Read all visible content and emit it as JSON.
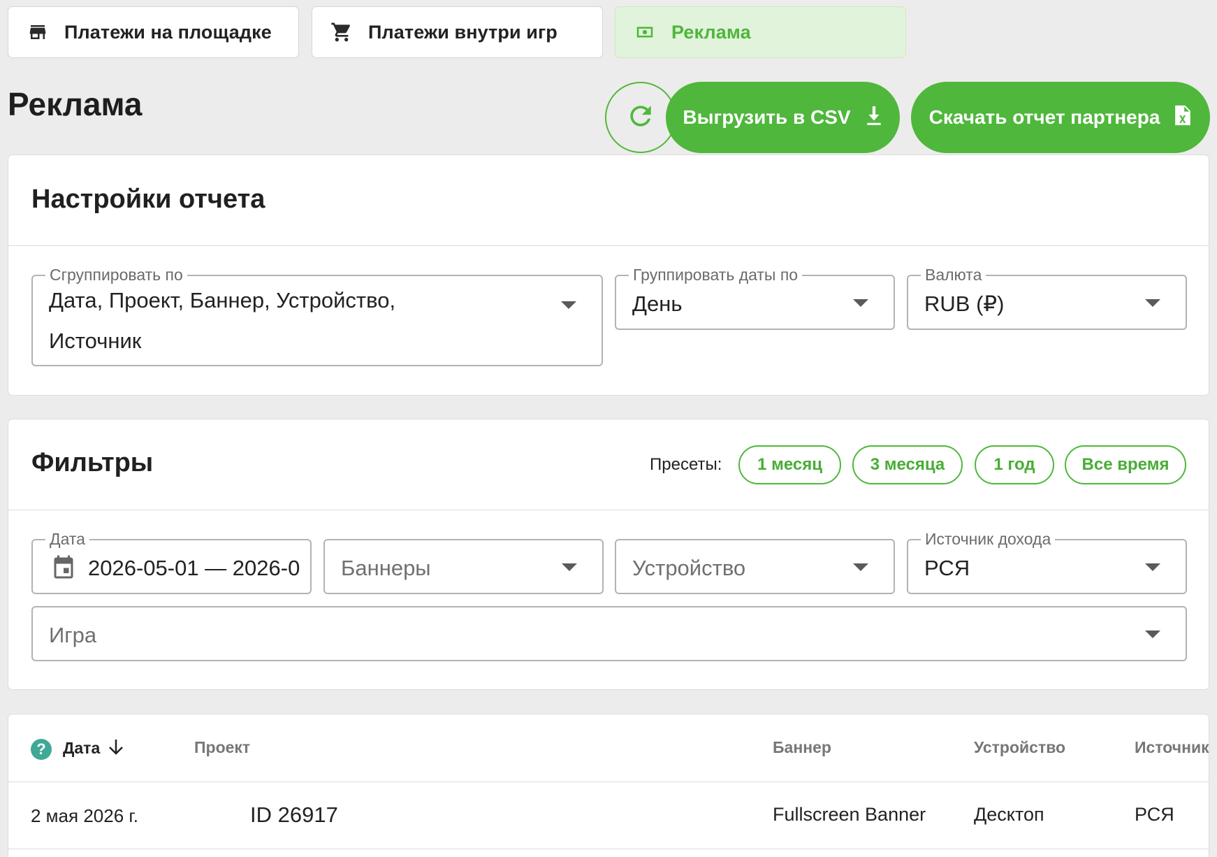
{
  "tabs": [
    {
      "label": "Платежи на площадке",
      "icon": "store-icon"
    },
    {
      "label": "Платежи внутри игр",
      "icon": "cart-icon"
    },
    {
      "label": "Реклама",
      "icon": "cash-icon",
      "active": true
    }
  ],
  "header": {
    "title": "Реклама",
    "csv_button": "Выгрузить в CSV",
    "partner_button": "Скачать отчет партнера"
  },
  "settings": {
    "title": "Настройки отчета",
    "group_by": {
      "label": "Сгруппировать по",
      "value_line1": "Дата, Проект, Баннер, Устройство,",
      "value_line2": "Источник"
    },
    "group_dates": {
      "label": "Группировать даты по",
      "value": "День"
    },
    "currency": {
      "label": "Валюта",
      "value": "RUB (₽)"
    }
  },
  "filters": {
    "title": "Фильтры",
    "presets_label": "Пресеты:",
    "presets": [
      "1 месяц",
      "3 месяца",
      "1 год",
      "Все время"
    ],
    "date": {
      "label": "Дата",
      "value": "2026-05-01 — 2026-0"
    },
    "banners": {
      "placeholder": "Баннеры"
    },
    "device": {
      "placeholder": "Устройство"
    },
    "income_source": {
      "label": "Источник дохода",
      "value": "РСЯ"
    },
    "game": {
      "placeholder": "Игра"
    }
  },
  "table": {
    "columns": [
      "Дата",
      "Проект",
      "Баннер",
      "Устройство",
      "Источник"
    ],
    "rows": [
      {
        "date": "2 мая 2026 г.",
        "project": "ID 26917",
        "banner": "Fullscreen Banner",
        "device": "Десктоп",
        "source": "РСЯ"
      }
    ]
  },
  "colors": {
    "accent": "#4fb73c",
    "active_tab_bg": "#e1f3da",
    "help_icon": "#3fa896"
  }
}
